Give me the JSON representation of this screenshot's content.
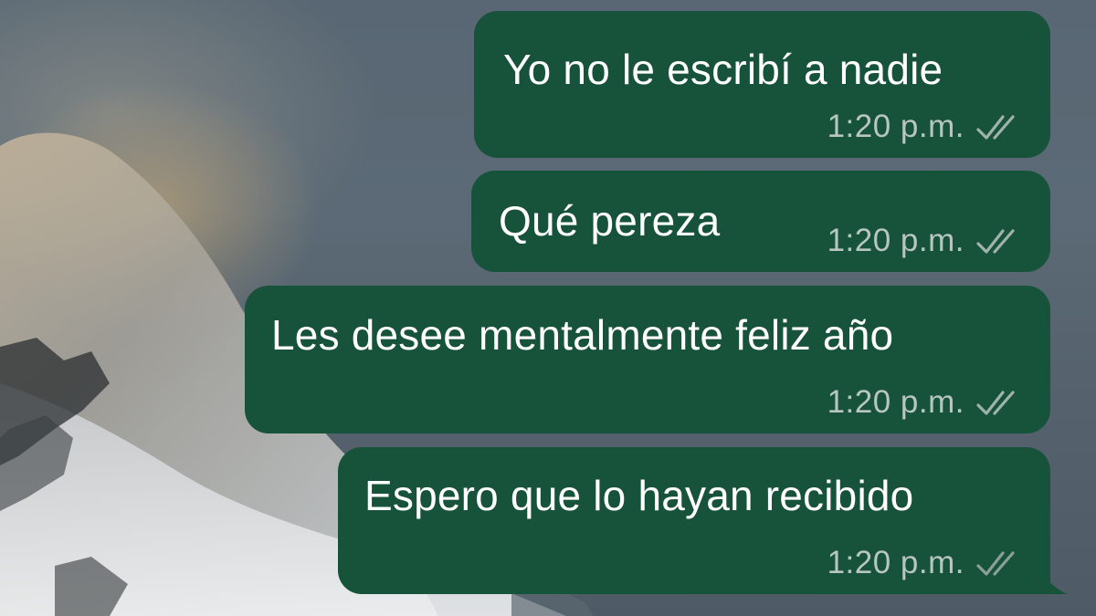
{
  "chat": {
    "messages": [
      {
        "text": "Yo no le escribí a nadie",
        "time": "1:20 p.m.",
        "status_icon": "double-check-icon"
      },
      {
        "text": "Qué pereza",
        "time": "1:20 p.m.",
        "status_icon": "double-check-icon"
      },
      {
        "text": "Les desee mentalmente feliz año",
        "time": "1:20 p.m.",
        "status_icon": "double-check-icon"
      },
      {
        "text": "Espero que lo hayan recibido",
        "time": "1:20 p.m.",
        "status_icon": "double-check-icon"
      }
    ],
    "colors": {
      "outgoing_bubble": "#17523a",
      "message_text": "#ffffff",
      "meta_text": "#b7c6bf"
    }
  }
}
